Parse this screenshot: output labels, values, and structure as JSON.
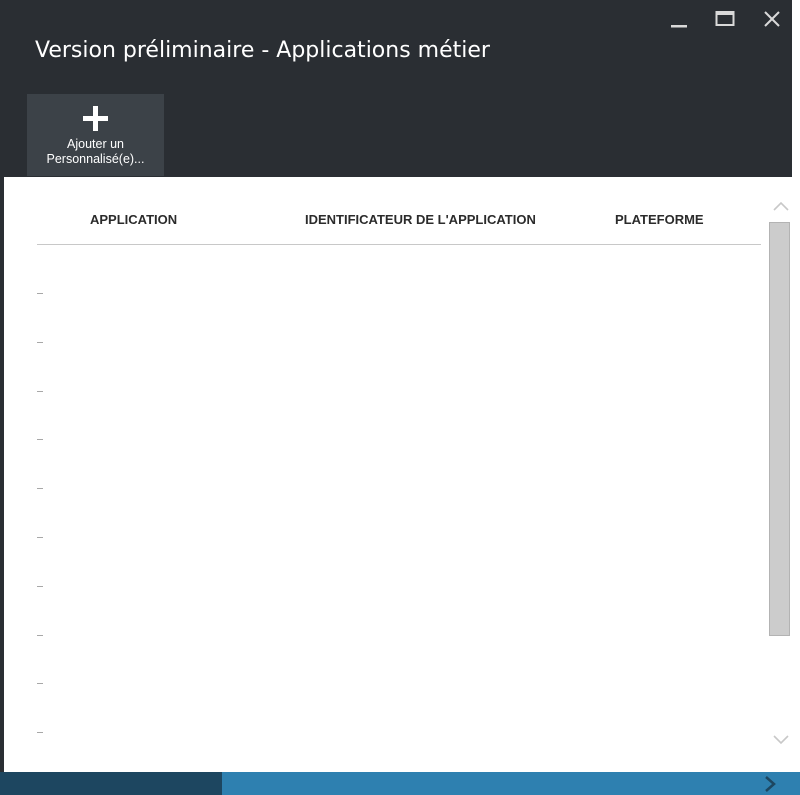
{
  "window": {
    "title": "Version préliminaire - Applications métier"
  },
  "window_controls": {
    "minimize_icon": "minimize-icon",
    "maximize_icon": "maximize-icon",
    "close_icon": "close-icon"
  },
  "toolbar": {
    "add_icon": "plus-icon",
    "add_label_line1": "Ajouter un",
    "add_label_line2": "Personnalisé(e)..."
  },
  "table": {
    "columns": [
      "APPLICATION",
      "IDENTIFICATEUR DE L'APPLICATION",
      "PLATEFORME"
    ],
    "rows": [
      {
        "application": "–",
        "identifier": "",
        "platform": ""
      },
      {
        "application": "–",
        "identifier": "",
        "platform": ""
      },
      {
        "application": "–",
        "identifier": "",
        "platform": ""
      },
      {
        "application": "–",
        "identifier": "",
        "platform": ""
      },
      {
        "application": "–",
        "identifier": "",
        "platform": ""
      },
      {
        "application": "–",
        "identifier": "",
        "platform": ""
      },
      {
        "application": "–",
        "identifier": "",
        "platform": ""
      },
      {
        "application": "–",
        "identifier": "",
        "platform": ""
      },
      {
        "application": "–",
        "identifier": "",
        "platform": ""
      },
      {
        "application": "–",
        "identifier": "",
        "platform": ""
      }
    ]
  },
  "colors": {
    "header_bg": "#2a2e33",
    "command_bg": "#3c4248",
    "accent_blue": "#2e80b0",
    "scrollbar": "#cccccc"
  }
}
